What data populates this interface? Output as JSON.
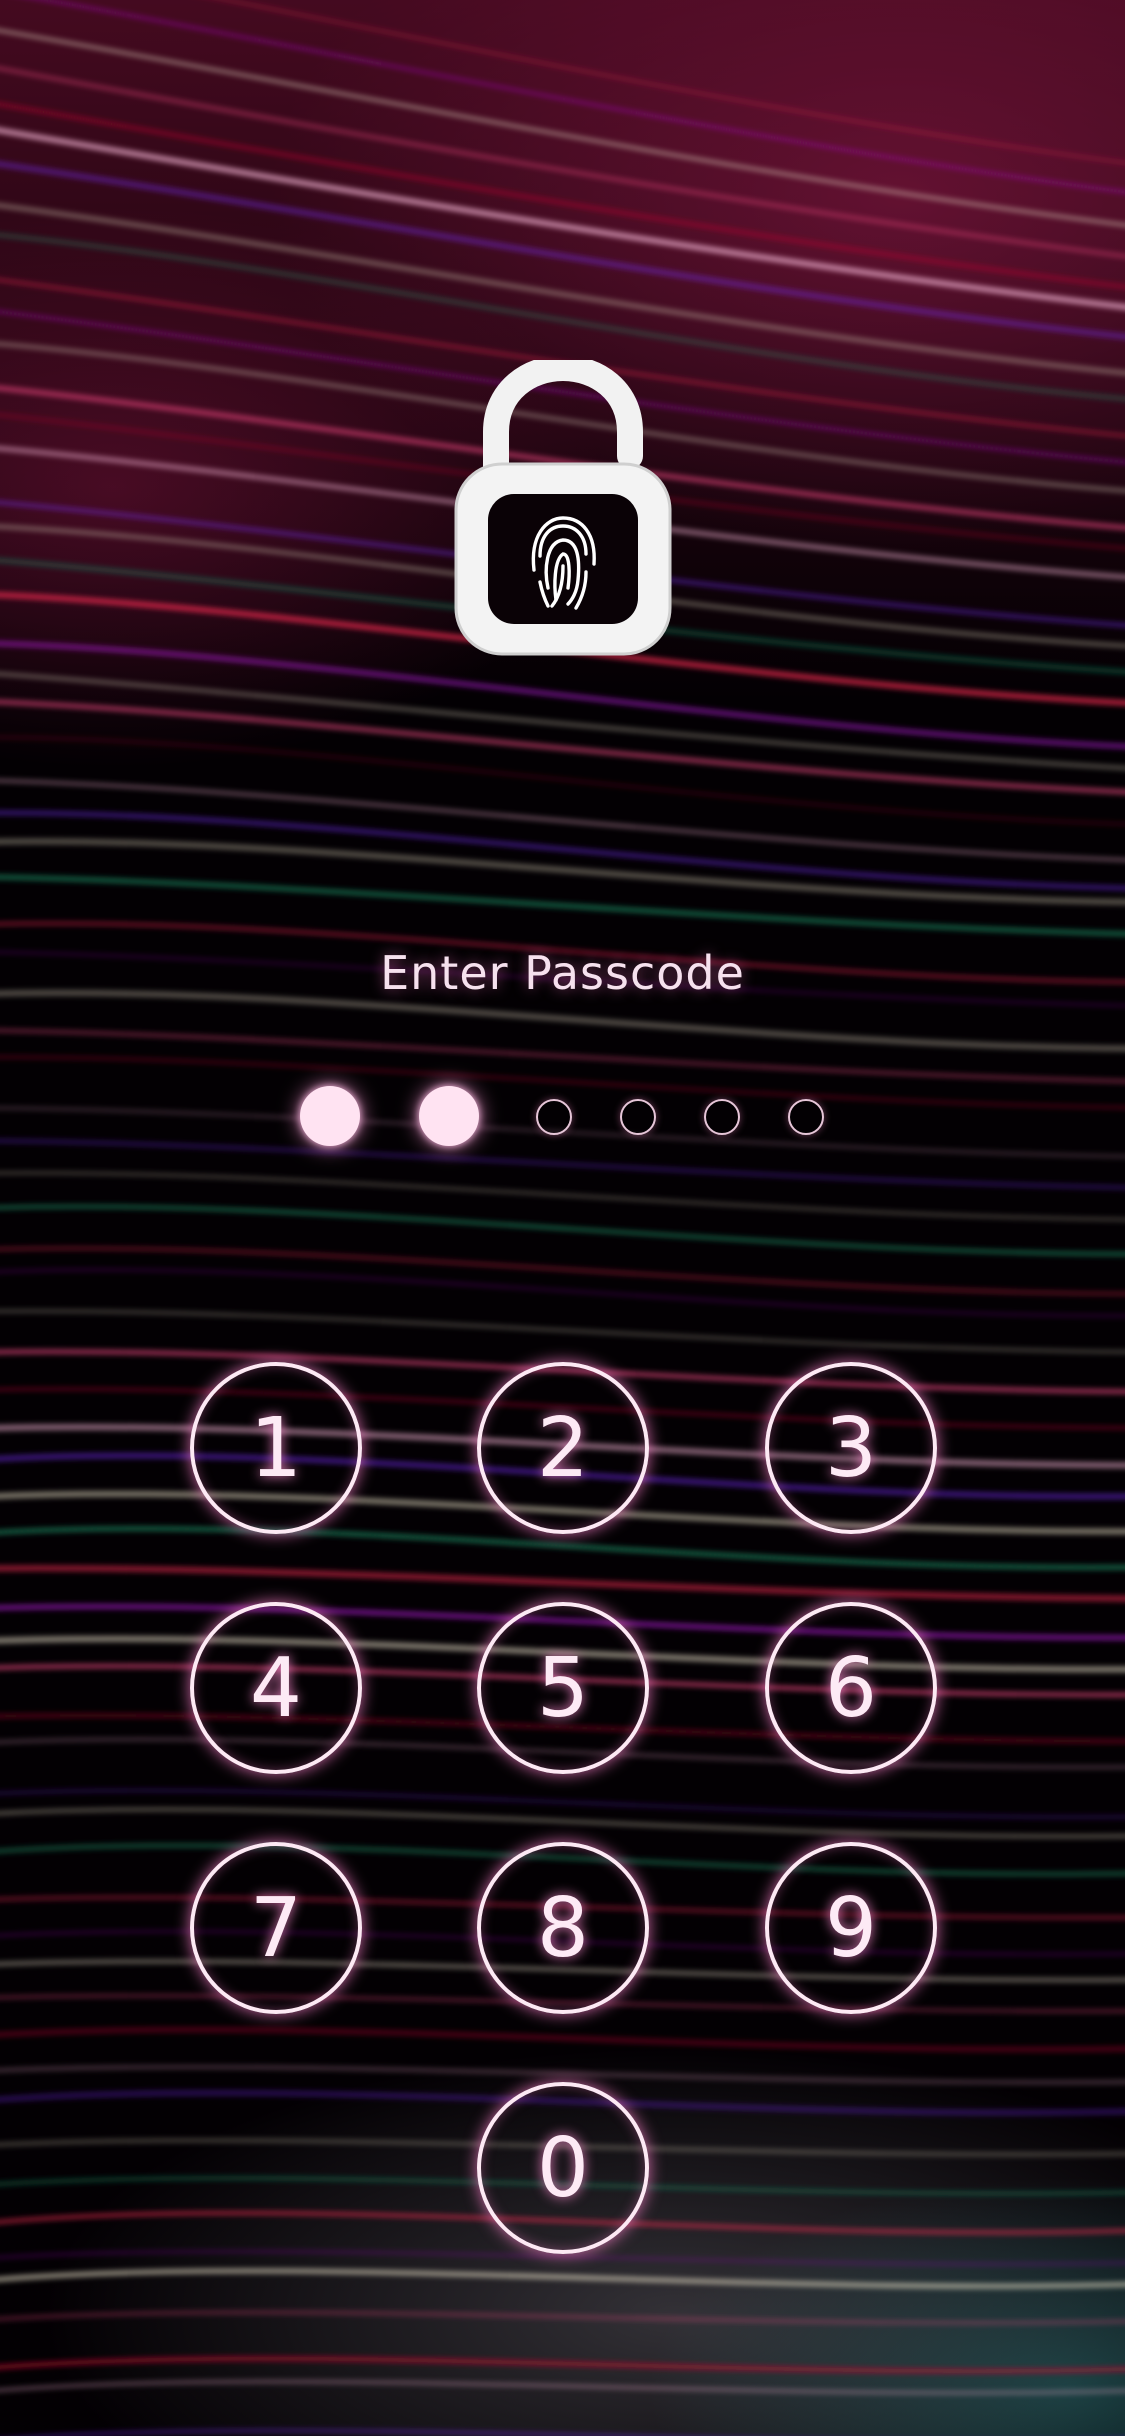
{
  "screen": {
    "title": "Enter Passcode"
  },
  "lock_icon": {
    "name": "unlocked-padlock-with-fingerprint",
    "color": "#ffffff"
  },
  "passcode": {
    "length": 6,
    "entered": 2
  },
  "keypad": {
    "keys": [
      "1",
      "2",
      "3",
      "4",
      "5",
      "6",
      "7",
      "8",
      "9",
      "0"
    ]
  },
  "colors": {
    "accent_glow": "#ff82cd",
    "key_outline": "#fde9f4"
  }
}
